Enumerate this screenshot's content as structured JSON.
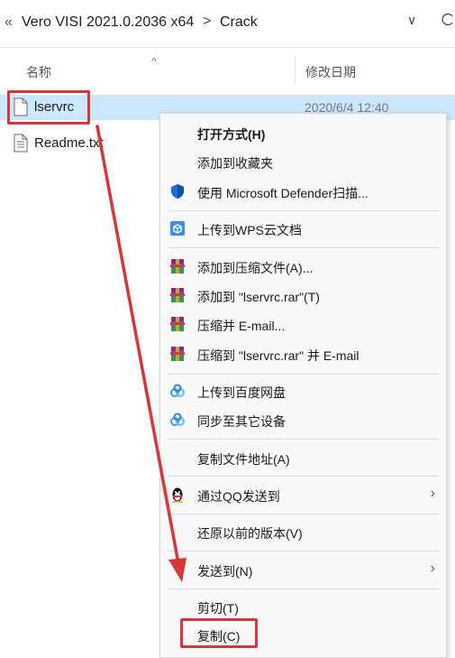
{
  "address_bar": {
    "overflow_chevron": "«",
    "crumbs": [
      "Vero VISI 2021.0.2036 x64",
      "Crack"
    ],
    "separator": ">",
    "dropdown_glyph": "∨"
  },
  "columns": {
    "name": "名称",
    "date_modified": "修改日期"
  },
  "files": [
    {
      "name": "lservrc",
      "date": "2020/6/4 12:40",
      "selected": true
    },
    {
      "name": "Readme.txt",
      "date": "",
      "selected": false
    }
  ],
  "context_menu": {
    "items": [
      {
        "label": "打开方式(H)",
        "bold": true,
        "icon": ""
      },
      {
        "label": "添加到收藏夹",
        "icon": ""
      },
      {
        "label": "使用 Microsoft Defender扫描...",
        "icon": "defender-shield-icon"
      },
      {
        "label": "上传到WPS云文档",
        "icon": "wps-cloud-icon"
      },
      {
        "label": "添加到压缩文件(A)...",
        "icon": "winrar-icon"
      },
      {
        "label": "添加到 \"lservrc.rar\"(T)",
        "icon": "winrar-icon"
      },
      {
        "label": "压缩并 E-mail...",
        "icon": "winrar-icon"
      },
      {
        "label": "压缩到 \"lservrc.rar\" 并 E-mail",
        "icon": "winrar-icon"
      },
      {
        "label": "上传到百度网盘",
        "icon": "baidu-netdisk-icon"
      },
      {
        "label": "同步至其它设备",
        "icon": "baidu-netdisk-icon"
      },
      {
        "label": "复制文件地址(A)",
        "icon": ""
      },
      {
        "label": "通过QQ发送到",
        "icon": "qq-penguin-icon",
        "submenu": true
      },
      {
        "label": "还原以前的版本(V)",
        "icon": ""
      },
      {
        "label": "发送到(N)",
        "icon": "",
        "submenu": true
      },
      {
        "label": "剪切(T)",
        "icon": ""
      },
      {
        "label": "复制(C)",
        "icon": ""
      }
    ],
    "submenu_glyph": "›"
  },
  "colors": {
    "selection": "#cce8ff",
    "annotation_red": "#d8363a",
    "defender_blue": "#1c6fd8",
    "wps_blue": "#3b8ee8"
  }
}
